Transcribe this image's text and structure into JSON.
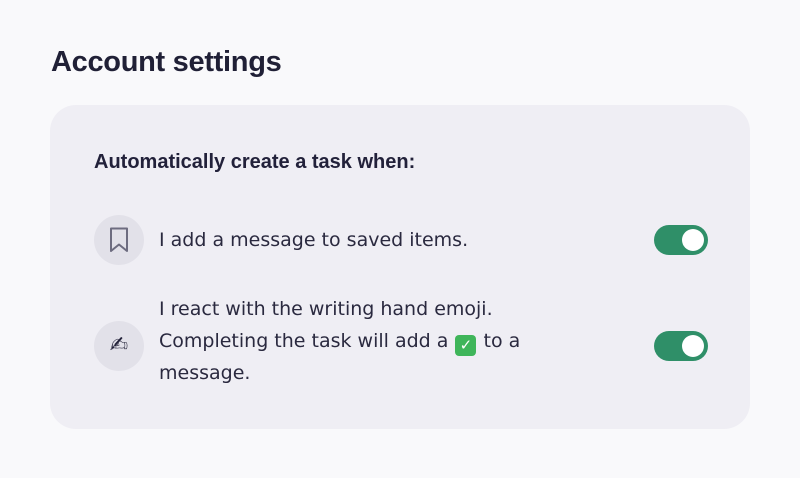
{
  "page": {
    "title": "Account settings"
  },
  "card": {
    "heading": "Automatically create a task when:",
    "rows": [
      {
        "icon": "bookmark-icon",
        "lines": [
          "I add a message to saved items."
        ],
        "toggle": {
          "on": true
        }
      },
      {
        "icon": "writing-hand-emoji",
        "emoji": "✍",
        "lines": [
          "I react with the writing hand emoji.",
          "Completing the task will add a",
          "to a",
          "message."
        ],
        "check_emoji": "✓",
        "toggle": {
          "on": true
        }
      }
    ]
  },
  "colors": {
    "page_background": "#f9f9fb",
    "card_background": "#efeef4",
    "toggle_on": "#2f8f68",
    "check_emoji": "#3fb55a",
    "text": "#24233a"
  }
}
